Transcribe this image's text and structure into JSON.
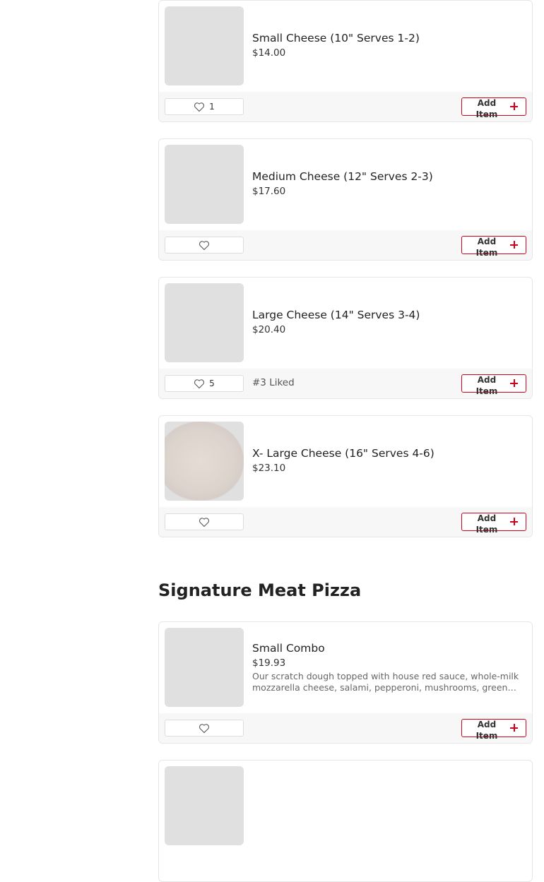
{
  "cheese_items": [
    {
      "name": "Small Cheese (10\" Serves 1-2)",
      "price": "$14.00",
      "likes": "1",
      "liked_text": ""
    },
    {
      "name": "Medium Cheese (12\" Serves 2-3)",
      "price": "$17.60",
      "likes": "",
      "liked_text": ""
    },
    {
      "name": "Large Cheese (14\" Serves 3-4)",
      "price": "$20.40",
      "likes": "5",
      "liked_text": "#3 Liked"
    },
    {
      "name": "X- Large Cheese (16\" Serves 4-6)",
      "price": "$23.10",
      "likes": "",
      "liked_text": ""
    }
  ],
  "section": {
    "title": "Signature Meat Pizza"
  },
  "meat_items": [
    {
      "name": "Small Combo",
      "price": "$19.93",
      "description": "Our scratch dough topped with house red sauce, whole-milk mozzarella cheese, salami, pepperoni, mushrooms, green peppers, onions and black olives.",
      "likes": ""
    }
  ],
  "add_label": "Add Item",
  "icons": {
    "like": "heart-outline-icon",
    "add": "plus-icon"
  },
  "colors": {
    "accent": "#d0021b",
    "footer_bg": "#f7f7f7",
    "placeholder": "#e0e0e0"
  }
}
